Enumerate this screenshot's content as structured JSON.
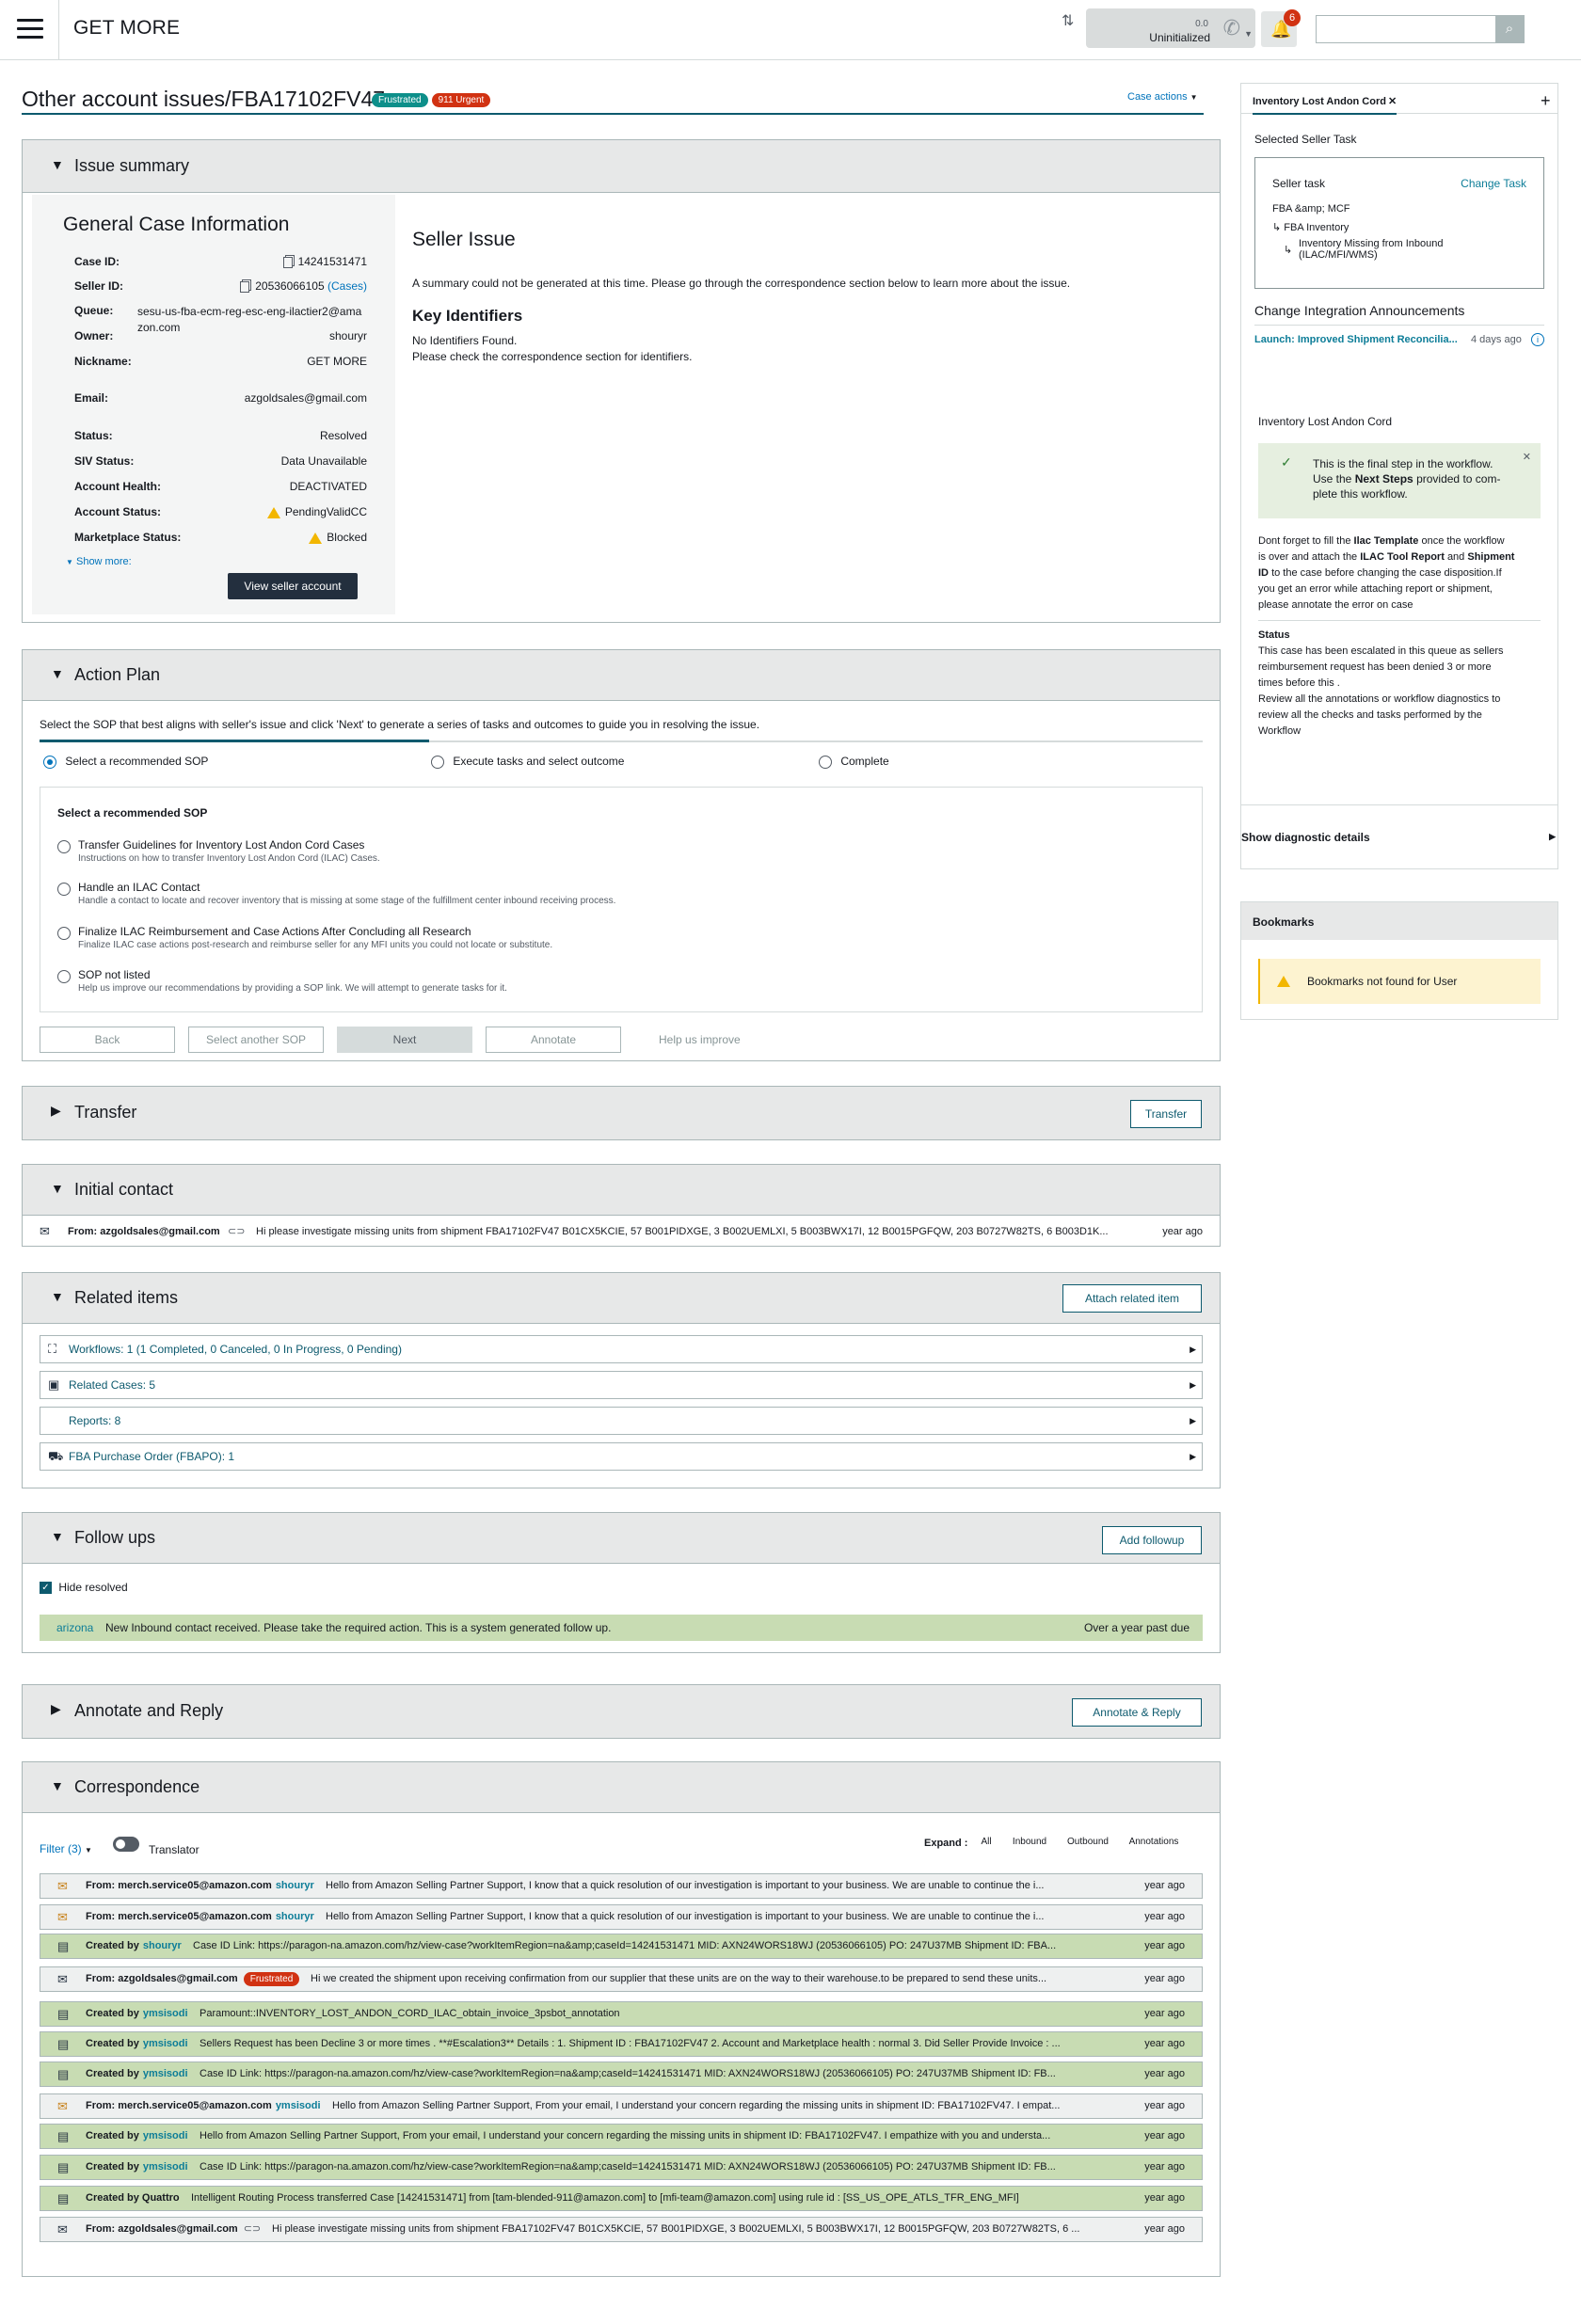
{
  "header": {
    "app_title": "GET MORE",
    "phone_count": "0.0",
    "phone_status": "Uninitialized",
    "notification_count": "6",
    "search_button_icon": "search-icon"
  },
  "case": {
    "title": "Other account issues/FBA17102FV47",
    "badge_frustrated": "Frustrated",
    "badge_urgent": "911 Urgent",
    "actions_label": "Case actions"
  },
  "issue_summary": {
    "title": "Issue summary",
    "gci_title": "General Case Information",
    "fields": {
      "case_id_label": "Case ID:",
      "case_id": "14241531471",
      "seller_id_label": "Seller ID:",
      "seller_id": "20536066105",
      "seller_cases": "(Cases)",
      "queue_label": "Queue:",
      "queue": "sesu-us-fba-ecm-reg-esc-eng-ilactier2@amazon.com",
      "owner_label": "Owner:",
      "owner": "shouryr",
      "nickname_label": "Nickname:",
      "nickname": "GET MORE",
      "email_label": "Email:",
      "email": "azgoldsales@gmail.com",
      "status_label": "Status:",
      "status": "Resolved",
      "siv_label": "SIV Status:",
      "siv": "Data Unavailable",
      "health_label": "Account Health:",
      "health": "DEACTIVATED",
      "acct_status_label": "Account Status:",
      "acct_status": "PendingValidCC",
      "mkt_status_label": "Marketplace Status:",
      "mkt_status": "Blocked"
    },
    "show_more": "Show more:",
    "view_seller_btn": "View seller account",
    "seller_issue_title": "Seller Issue",
    "seller_issue_text": "A summary could not be generated at this time. Please go through the correspondence section below to learn more about the issue.",
    "key_identifiers_title": "Key Identifiers",
    "no_identifiers": "No Identifiers Found.",
    "check_correspondence": "Please check the correspondence section for identifiers."
  },
  "action_plan": {
    "title": "Action Plan",
    "intro": "Select the SOP that best aligns with seller's issue and click 'Next' to generate a series of tasks and outcomes to guide you in resolving the issue.",
    "steps": [
      "Select a recommended SOP",
      "Execute tasks and select outcome",
      "Complete"
    ],
    "sop_heading": "Select a recommended SOP",
    "sops": [
      {
        "title": "Transfer Guidelines for Inventory Lost Andon Cord Cases",
        "desc": "Instructions on how to transfer Inventory Lost Andon Cord (ILAC) Cases."
      },
      {
        "title": "Handle an ILAC Contact",
        "desc": "Handle a contact to locate and recover inventory that is missing at some stage of the fulfillment center inbound receiving process."
      },
      {
        "title": "Finalize ILAC Reimbursement and Case Actions After Concluding all Research",
        "desc": "Finalize ILAC case actions post-research and reimburse seller for any MFI units you could not locate or substitute."
      },
      {
        "title": "SOP not listed",
        "desc": "Help us improve our recommendations by providing a SOP link. We will attempt to generate tasks for it."
      }
    ],
    "buttons": {
      "back": "Back",
      "select_another": "Select another SOP",
      "next": "Next",
      "annotate": "Annotate",
      "help": "Help us improve"
    }
  },
  "transfer": {
    "title": "Transfer",
    "button": "Transfer"
  },
  "initial_contact": {
    "title": "Initial contact",
    "from": "From: azgoldsales@gmail.com",
    "message": "Hi please investigate missing units from shipment FBA17102FV47 B01CX5KCIE, 57 B001PIDXGE, 3 B002UEMLXI, 5 B003BWX17I, 12 B0015PGFQW, 203 B0727W82TS, 6 B003D1K...",
    "time": "year ago"
  },
  "related_items": {
    "title": "Related items",
    "attach_button": "Attach related item",
    "rows": [
      {
        "label": "Workflows: 1 (1 Completed, 0 Canceled, 0 In Progress, 0 Pending)",
        "icon": "workflow-icon"
      },
      {
        "label": "Related Cases: 5",
        "icon": "cases-icon"
      },
      {
        "label": "Reports: 8",
        "icon": ""
      },
      {
        "label": "FBA Purchase Order (FBAPO): 1",
        "icon": "truck-icon"
      }
    ]
  },
  "follow_ups": {
    "title": "Follow ups",
    "add_button": "Add followup",
    "hide_resolved": "Hide resolved",
    "row": {
      "owner": "arizona",
      "message": "New Inbound contact received. Please take the required action. This is a system generated follow up.",
      "due": "Over a year past due"
    }
  },
  "annotate_reply": {
    "title": "Annotate and Reply",
    "button": "Annotate & Reply"
  },
  "correspondence": {
    "title": "Correspondence",
    "filter": "Filter (3)",
    "translator": "Translator",
    "expand_label": "Expand :",
    "expand_options": [
      "All",
      "Inbound",
      "Outbound",
      "Annotations"
    ],
    "rows": [
      {
        "kind": "w",
        "icon": "outbound-mail-icon",
        "prefix": "From: merch.service05@amazon.com",
        "who": "shouryr",
        "badge": "",
        "message": "Hello from Amazon Selling Partner Support, I know that a quick resolution of our investigation is important to your business. We are unable to continue the i...",
        "time": "year ago"
      },
      {
        "kind": "w",
        "icon": "outbound-mail-icon",
        "prefix": "From: merch.service05@amazon.com",
        "who": "shouryr",
        "badge": "",
        "message": "Hello from Amazon Selling Partner Support, I know that a quick resolution of our investigation is important to your business. We are unable to continue the i...",
        "time": "year ago"
      },
      {
        "kind": "g",
        "icon": "annotation-icon",
        "prefix": "Created by",
        "who": "shouryr",
        "badge": "",
        "message": "Case ID Link: https://paragon-na.amazon.com/hz/view-case?workItemRegion=na&amp;caseId=14241531471 MID: AXN24WORS18WJ (20536066105) PO: 247U37MB Shipment ID: FBA...",
        "time": "year ago"
      },
      {
        "kind": "w",
        "icon": "inbound-mail-icon",
        "prefix": "From: azgoldsales@gmail.com",
        "who": "",
        "badge": "Frustrated",
        "message": "Hi we created the shipment upon receiving confirmation from our supplier that these units are on the way to their warehouse.to be prepared to send these units...",
        "time": "year ago"
      },
      {
        "kind": "g",
        "icon": "annotation-icon",
        "prefix": "Created by",
        "who": "ymsisodi",
        "badge": "",
        "message": "Paramount::INVENTORY_LOST_ANDON_CORD_ILAC_obtain_invoice_3psbot_annotation",
        "time": "year ago"
      },
      {
        "kind": "g",
        "icon": "annotation-icon",
        "prefix": "Created by",
        "who": "ymsisodi",
        "badge": "",
        "message": "Sellers Request has been Decline 3 or more times . **#Escalation3** Details : 1. Shipment ID : FBA17102FV47 2. Account and Marketplace health : normal 3. Did Seller Provide Invoice : ...",
        "time": "year ago"
      },
      {
        "kind": "g",
        "icon": "annotation-icon",
        "prefix": "Created by",
        "who": "ymsisodi",
        "badge": "",
        "message": "Case ID Link: https://paragon-na.amazon.com/hz/view-case?workItemRegion=na&amp;caseId=14241531471 MID: AXN24WORS18WJ (20536066105) PO: 247U37MB Shipment ID: FB...",
        "time": "year ago"
      },
      {
        "kind": "w",
        "icon": "outbound-mail-icon",
        "prefix": "From: merch.service05@amazon.com",
        "who": "ymsisodi",
        "badge": "",
        "message": "Hello from Amazon Selling Partner Support, From your email, I understand your concern regarding the missing units in shipment ID: FBA17102FV47. I empat...",
        "time": "year ago"
      },
      {
        "kind": "g",
        "icon": "annotation-icon",
        "prefix": "Created by",
        "who": "ymsisodi",
        "badge": "",
        "message": "Hello from Amazon Selling Partner Support, From your email, I understand your concern regarding the missing units in shipment ID: FBA17102FV47. I empathize with you and understa...",
        "time": "year ago"
      },
      {
        "kind": "g",
        "icon": "annotation-icon",
        "prefix": "Created by",
        "who": "ymsisodi",
        "badge": "",
        "message": "Case ID Link: https://paragon-na.amazon.com/hz/view-case?workItemRegion=na&amp;caseId=14241531471 MID: AXN24WORS18WJ (20536066105) PO: 247U37MB Shipment ID: FB...",
        "time": "year ago"
      },
      {
        "kind": "g",
        "icon": "annotation-icon",
        "prefix": "Created by Quattro",
        "who": "",
        "badge": "",
        "message": "Intelligent Routing Process transferred Case [14241531471] from [tam-blended-911@amazon.com] to [mfi-team@amazon.com] using rule id : [SS_US_OPE_ATLS_TFR_ENG_MFI]",
        "time": "year ago"
      },
      {
        "kind": "w",
        "icon": "inbound-mail-icon",
        "prefix": "From: azgoldsales@gmail.com",
        "who": "",
        "badge": "",
        "message": "Hi please investigate missing units from shipment FBA17102FV47 B01CX5KCIE, 57 B001PIDXGE, 3 B002UEMLXI, 5 B003BWX17I, 12 B0015PGFQW, 203 B0727W82TS, 6 ...",
        "time": "year ago"
      }
    ]
  },
  "right_panel": {
    "tab_label": "Inventory Lost Andon Cord",
    "selected_seller_task": "Selected Seller Task",
    "seller_task_label": "Seller task",
    "change_task": "Change Task",
    "task_path_1": "FBA &amp; MCF",
    "task_path_2": "FBA Inventory",
    "task_path_3": "Inventory Missing from Inbound (ILAC/MFI/WMS)",
    "announcements_title": "Change Integration Announcements",
    "announcement_link": "Launch: Improved Shipment Reconcilia...",
    "announcement_time": "4 days ago",
    "workflow_title": "Inventory Lost Andon Cord",
    "final_step_1": "This is the final step in the workflow.",
    "final_step_2a": "Use the",
    "final_step_2b": "Next Steps",
    "final_step_2c": "provided to com-",
    "final_step_3": "plete this workflow.",
    "note_1a": "Dont forget to fill the",
    "note_1b": "Ilac Template",
    "note_1c": "once the workflow",
    "note_2a": "is over and attach the",
    "note_2b": "ILAC Tool Report",
    "note_2c": "and",
    "note_2d": "Shipment",
    "note_3a": "ID",
    "note_3b": "to the case before changing the case disposition.If",
    "note_4": "you get an error while attaching report or shipment,",
    "note_5": "please annotate the error on case",
    "status_title": "Status",
    "status_1": "This case has been escalated in this queue as sellers",
    "status_2": "reimbursement request has been denied 3 or more",
    "status_3": "times before this .",
    "status_4": "Review all the annotations or workflow diagnostics to",
    "status_5": "review all the checks and tasks performed by the",
    "status_6": "Workflow",
    "diagnostic": "Show diagnostic details",
    "bookmarks_title": "Bookmarks",
    "bookmarks_empty": "Bookmarks not found for User"
  }
}
